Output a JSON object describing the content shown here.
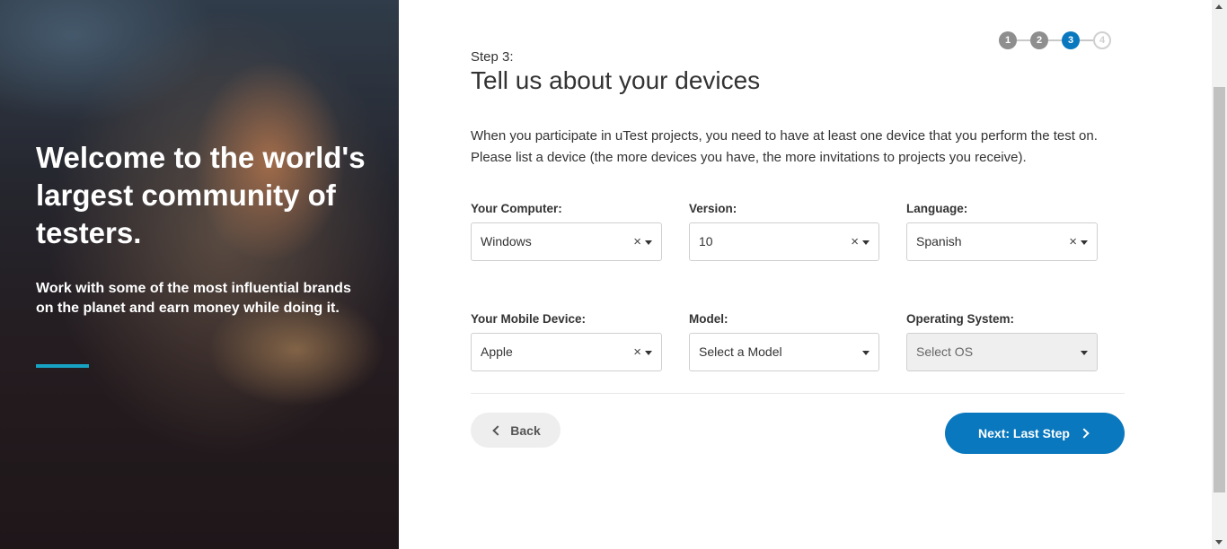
{
  "hero": {
    "title": "Welcome to the world's largest community of testers.",
    "subtitle": "Work with some of the most influential brands on the planet and earn money while doing it.",
    "accent_color": "#16a3c4"
  },
  "stepper": {
    "steps": [
      "1",
      "2",
      "3",
      "4"
    ],
    "current": 3,
    "active_color": "#0a78be"
  },
  "header": {
    "step_label": "Step 3:",
    "title": "Tell us about your devices"
  },
  "intro": "When you participate in uTest projects, you need to have at least one device that you perform the test on. Please list a device (the more devices you have, the more invitations to projects you receive).",
  "computer": {
    "label": "Your Computer:",
    "value": "Windows"
  },
  "version": {
    "label": "Version:",
    "value": "10"
  },
  "language": {
    "label": "Language:",
    "value": "Spanish"
  },
  "mobile": {
    "label": "Your Mobile Device:",
    "value": "Apple"
  },
  "model": {
    "label": "Model:",
    "value": "Select a Model"
  },
  "os": {
    "label": "Operating System:",
    "value": "Select OS"
  },
  "icons": {
    "clear": "×"
  },
  "buttons": {
    "back": "Back",
    "next": "Next: Last Step"
  }
}
